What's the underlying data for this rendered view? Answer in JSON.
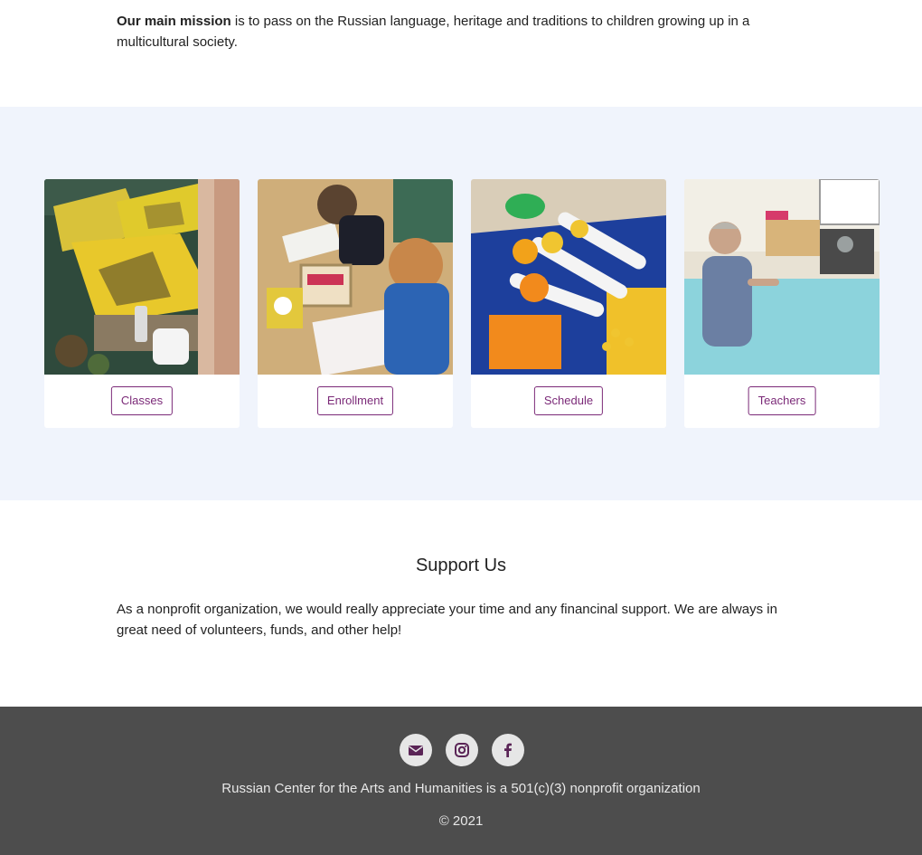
{
  "mission": {
    "bold": "Our main mission",
    "text": " is to pass on the Russian language, heritage and traditions to children growing up in a multicultural society."
  },
  "cards": [
    {
      "label": "Classes",
      "icon": "paint-photo"
    },
    {
      "label": "Enrollment",
      "icon": "kids-writing-photo"
    },
    {
      "label": "Schedule",
      "icon": "paper-craft-photo"
    },
    {
      "label": "Teachers",
      "icon": "teacher-classroom-photo"
    }
  ],
  "support": {
    "title": "Support Us",
    "text": "As a nonprofit organization, we would really appreciate your time and any financinal support. We are always in great need of volunteers, funds, and other help!"
  },
  "footer": {
    "social": [
      "envelope-icon",
      "instagram-icon",
      "facebook-icon"
    ],
    "org_text": "Russian Center for the Arts and Humanities is a 501(c)(3) nonprofit organization",
    "copyright": "© 2021"
  },
  "colors": {
    "accent": "#7b2a78",
    "section_bg": "#f0f4fc",
    "footer_bg": "#4d4d4d",
    "icon_color": "#5a2456"
  }
}
